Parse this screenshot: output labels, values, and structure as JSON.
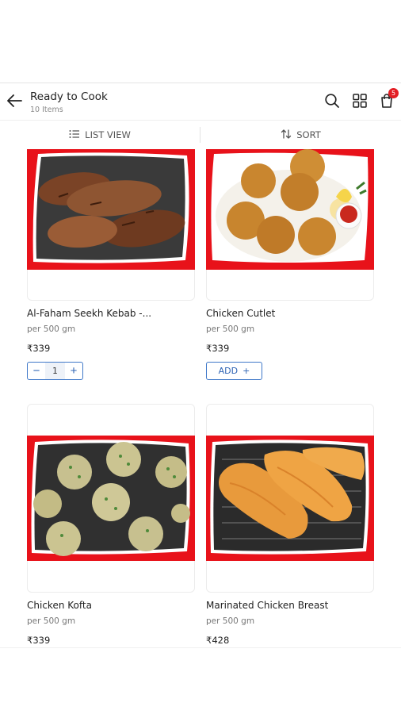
{
  "header": {
    "title": "Ready to Cook",
    "subtitle": "10 Items",
    "cart_count": "5",
    "icons": [
      "back-arrow-icon",
      "search-icon",
      "grid-icon",
      "cart-icon"
    ]
  },
  "toolbar": {
    "list_view_label": "LIST VIEW",
    "sort_label": "SORT"
  },
  "products": [
    {
      "name": "Al-Faham Seekh Kebab -...",
      "unit": "per 500 gm",
      "price": "₹339",
      "quantity": "1",
      "in_cart": true
    },
    {
      "name": "Chicken Cutlet",
      "unit": "per 500 gm",
      "price": "₹339",
      "add_label": "ADD",
      "in_cart": false
    },
    {
      "name": "Chicken Kofta",
      "unit": "per 500 gm",
      "price": "₹339",
      "in_cart": false
    },
    {
      "name": "Marinated Chicken Breast",
      "unit": "per 500 gm",
      "price": "₹428",
      "in_cart": false
    }
  ],
  "colors": {
    "brand_red": "#e8121a",
    "accent_blue": "#2f64b4",
    "badge_red": "#e31e24"
  }
}
